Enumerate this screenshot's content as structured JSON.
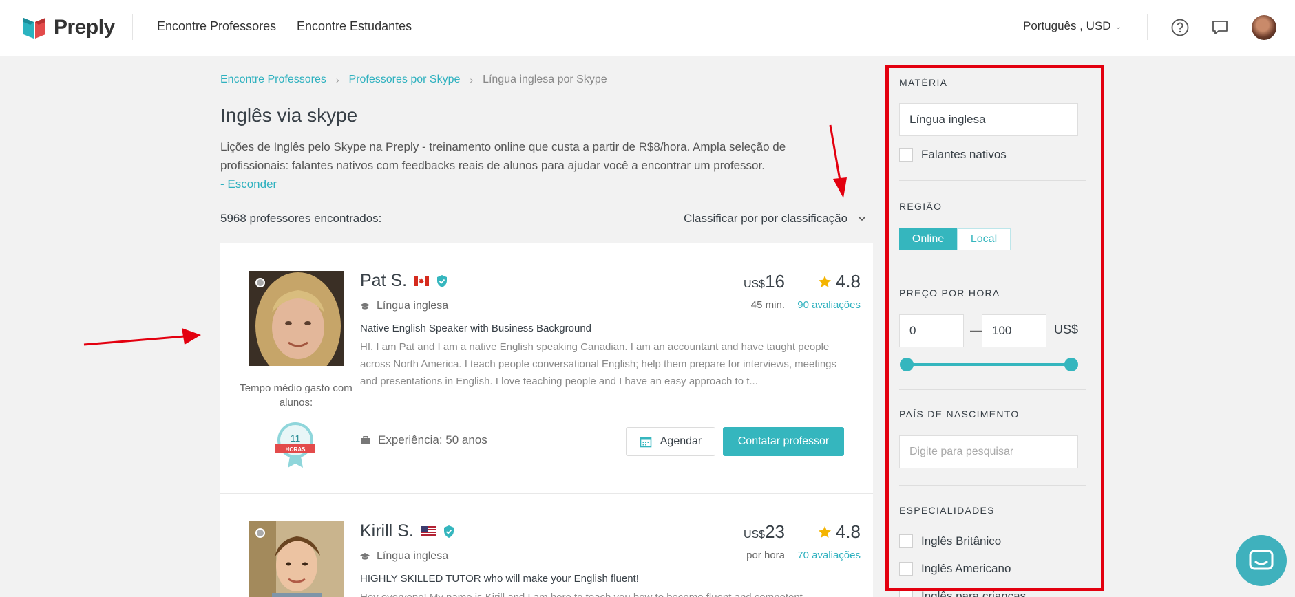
{
  "header": {
    "brand": "Preply",
    "nav": [
      "Encontre Professores",
      "Encontre Estudantes"
    ],
    "language_currency": "Português , USD"
  },
  "breadcrumb": [
    "Encontre Professores",
    "Professores por Skype",
    "Língua inglesa por Skype"
  ],
  "page": {
    "title": "Inglês via skype",
    "description": "Lições de Inglês pelo Skype na Preply - treinamento online que custa a partir de R$8/hora. Ampla seleção de profissionais: falantes nativos com feedbacks reais de alunos para ajudar você a encontrar um professor.",
    "hide_link": "- Esconder",
    "results_count": "5968 professores encontrados:",
    "sort_label": "Classificar por por classificação"
  },
  "tutors": [
    {
      "name": "Pat S.",
      "subject": "Língua inglesa",
      "headline": "Native English Speaker with Business Background",
      "bio": "HI. I am Pat and I am a native English speaking Canadian. I am an accountant and have taught people across North America. I teach people conversational English; help them prepare for interviews, meetings and presentations in English. I love teaching people and I have an easy approach to t...",
      "price_currency": "US$",
      "price_value": "16",
      "price_sub": "45 min.",
      "rating": "4.8",
      "reviews": "90 avaliações",
      "tempo_label": "Tempo médio gasto com alunos:",
      "badge_number": "11",
      "badge_unit": "HORAS",
      "experience": "Experiência: 50 anos",
      "schedule_button": "Agendar",
      "contact_button": "Contatar professor"
    },
    {
      "name": "Kirill S.",
      "subject": "Língua inglesa",
      "headline": "HIGHLY SKILLED TUTOR who will make your English fluent!",
      "bio": "Hey everyone! My name is Kirill and I am here to teach you how to become fluent and competent",
      "price_currency": "US$",
      "price_value": "23",
      "price_sub": "por hora",
      "rating": "4.8",
      "reviews": "70 avaliações"
    }
  ],
  "sidebar": {
    "subject_title": "MATÉRIA",
    "subject_value": "Língua inglesa",
    "native_speakers": "Falantes nativos",
    "region_title": "REGIÃO",
    "region_online": "Online",
    "region_local": "Local",
    "price_title": "PREÇO POR HORA",
    "price_min": "0",
    "price_max": "100",
    "price_currency": "US$",
    "country_title": "PAÍS DE NASCIMENTO",
    "country_placeholder": "Digite para pesquisar",
    "specialties_title": "ESPECIALIDADES",
    "specialties": [
      "Inglês Britânico",
      "Inglês Americano",
      "Inglês para crianças"
    ]
  },
  "colors": {
    "accent": "#35b6be",
    "link": "#2fb1bf",
    "annotation_red": "#e3000f",
    "star": "#f4b400"
  }
}
